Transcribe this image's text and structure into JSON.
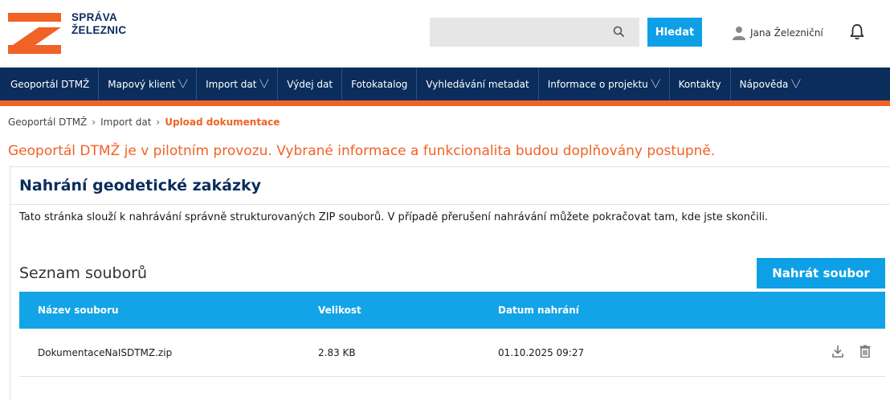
{
  "brand": {
    "line1": "SPRÁVA",
    "line2": "ŽELEZNIC",
    "colors": {
      "navy": "#0a2d5c",
      "orange": "#f06225",
      "blue": "#0ea0e6"
    }
  },
  "search": {
    "value": "",
    "placeholder": "",
    "icon": "search-icon",
    "button_label": "Hledat"
  },
  "user": {
    "name": "Jana Železniční",
    "icon": "user-icon",
    "bell_icon": "bell-icon"
  },
  "nav": [
    {
      "label": "Geoportál DTMŽ",
      "has_submenu": false
    },
    {
      "label": "Mapový klient",
      "has_submenu": true
    },
    {
      "label": "Import dat",
      "has_submenu": true
    },
    {
      "label": "Výdej dat",
      "has_submenu": false
    },
    {
      "label": "Fotokatalog",
      "has_submenu": false
    },
    {
      "label": "Vyhledávání metadat",
      "has_submenu": false
    },
    {
      "label": "Informace o projektu",
      "has_submenu": true
    },
    {
      "label": "Kontakty",
      "has_submenu": false
    },
    {
      "label": "Nápověda",
      "has_submenu": true
    }
  ],
  "breadcrumb": {
    "items": [
      "Geoportál DTMŽ",
      "Import dat"
    ],
    "current": "Upload dokumentace"
  },
  "pilot_notice": "Geoportál DTMŽ je v pilotním provozu. Vybrané informace a funkcionalita budou doplňovány postupně.",
  "card": {
    "title": "Nahrání geodetické zakázky",
    "description": "Tato stránka slouží k nahrávání správně strukturovaných ZIP souborů. V případě přerušení nahrávání můžete pokračovat tam, kde jste skončili.",
    "list_title": "Seznam souborů",
    "upload_button": "Nahrát soubor"
  },
  "table": {
    "headers": [
      "Název souboru",
      "Velikost",
      "Datum nahrání"
    ],
    "rows": [
      {
        "name": "DokumentaceNaISDTMZ.zip",
        "size": "2.83 KB",
        "date": "01.10.2025 09:27",
        "actions": [
          "download-icon",
          "trash-icon"
        ]
      }
    ]
  }
}
